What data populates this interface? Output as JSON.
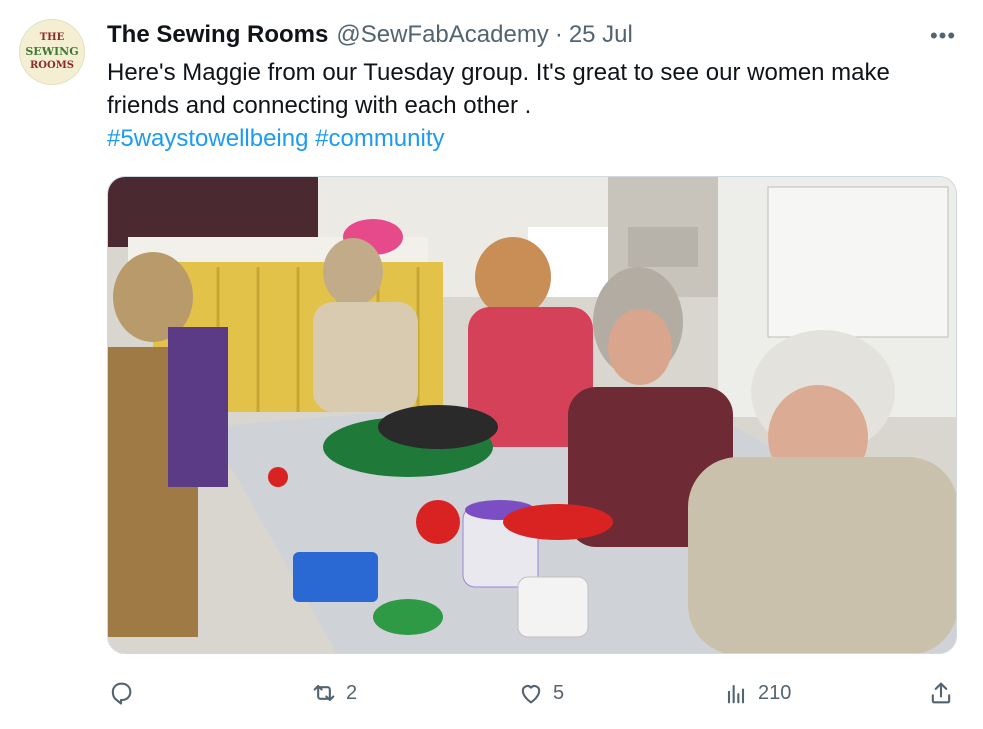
{
  "tweet": {
    "display_name": "The Sewing Rooms",
    "handle": "@SewFabAcademy",
    "separator": "·",
    "date": "25 Jul",
    "more_label": "•••",
    "text_line1": "Here's  Maggie from our Tuesday group. It's great to see our women make",
    "text_line2": "friends and connecting with each other .",
    "hashtags": "#5waystowellbeing #community"
  },
  "avatar": {
    "line1": "THE",
    "line2": "SEWING",
    "line3": "ROOMS"
  },
  "media": {
    "icon": "photo"
  },
  "actions": {
    "reply_icon": "reply-icon",
    "retweet_icon": "retweet-icon",
    "retweet_count": "2",
    "like_icon": "heart-icon",
    "like_count": "5",
    "views_icon": "analytics-icon",
    "views_count": "210",
    "share_icon": "share-icon"
  },
  "colors": {
    "text": "#0f1419",
    "secondary": "#536471",
    "link": "#1d9bf0",
    "border": "#cfd9de"
  }
}
